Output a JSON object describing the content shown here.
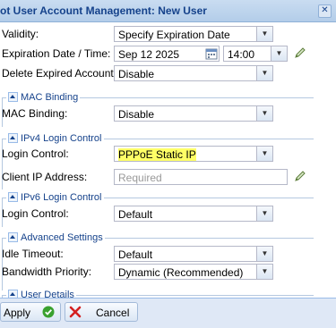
{
  "window": {
    "title": "ot User Account Management: New User"
  },
  "form": {
    "validity": {
      "label": "Validity:",
      "value": "Specify Expiration Date"
    },
    "expiration": {
      "label": "Expiration Date / Time:",
      "date": "Sep 12 2025",
      "time": "14:00"
    },
    "delete_expired": {
      "label": "Delete Expired Account:",
      "value": "Disable"
    }
  },
  "mac_binding": {
    "legend": "MAC Binding",
    "label": "MAC Binding:",
    "value": "Disable"
  },
  "ipv4": {
    "legend": "IPv4 Login Control",
    "login_label": "Login Control:",
    "login_value": "PPPoE Static IP",
    "client_ip_label": "Client IP Address:",
    "client_ip_placeholder": "Required"
  },
  "ipv6": {
    "legend": "IPv6 Login Control",
    "login_label": "Login Control:",
    "login_value": "Default"
  },
  "advanced": {
    "legend": "Advanced Settings",
    "idle_label": "Idle Timeout:",
    "idle_value": "Default",
    "bandwidth_label": "Bandwidth Priority:",
    "bandwidth_value": "Dynamic (Recommended)"
  },
  "user_details": {
    "legend": "User Details"
  },
  "buttons": {
    "apply": "Apply",
    "cancel": "Cancel"
  },
  "colors": {
    "highlight": "#ffff66",
    "accent": "#15428b",
    "apply_icon": "#3aa12e",
    "cancel_icon": "#d42020"
  }
}
